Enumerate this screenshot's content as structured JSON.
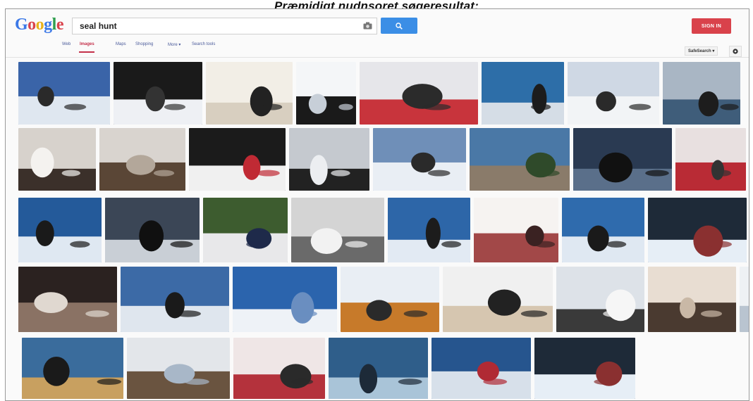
{
  "caption": "Præmidigt nudnsoret søgeresultat:",
  "header": {
    "logo_letters": [
      {
        "char": "G",
        "color": "#3b78e7"
      },
      {
        "char": "o",
        "color": "#d9424b"
      },
      {
        "char": "o",
        "color": "#e8b21c"
      },
      {
        "char": "g",
        "color": "#3b78e7"
      },
      {
        "char": "l",
        "color": "#2f9e4e"
      },
      {
        "char": "e",
        "color": "#d9424b"
      }
    ],
    "search": {
      "value": "seal hunt",
      "camera_icon": "camera-icon",
      "button_icon": "search-icon"
    },
    "signin_label": "SIGN IN"
  },
  "tabs": [
    {
      "label": "Web",
      "active": false
    },
    {
      "label": "Images",
      "active": true
    },
    {
      "label": "Maps",
      "active": false
    },
    {
      "label": "Shopping",
      "active": false
    },
    {
      "label": "More ▾",
      "active": false
    },
    {
      "label": "Search tools",
      "active": false
    }
  ],
  "toolbar": {
    "safesearch_label": "SafeSearch ▾",
    "settings_icon": "gear-icon"
  },
  "results": [
    {
      "scene": "ice-sled",
      "colors": [
        "#3a64a8",
        "#dfe7f0",
        "#2a2a2a"
      ]
    },
    {
      "scene": "dark-frame",
      "colors": [
        "#1a1a1a",
        "#eef0f4",
        "#333333"
      ]
    },
    {
      "scene": "white-pup",
      "colors": [
        "#f2eee6",
        "#d8cfc0",
        "#222222"
      ]
    },
    {
      "scene": "club-silhouette",
      "colors": [
        "#f4f6f8",
        "#1a1a1a",
        "#c7cfd8"
      ]
    },
    {
      "scene": "blood-ice-woman",
      "colors": [
        "#e6e6ea",
        "#c8343c",
        "#2b2b2b"
      ]
    },
    {
      "scene": "blue-sea-hunter",
      "colors": [
        "#2d6ea8",
        "#d5dde6",
        "#1c1c1c"
      ]
    },
    {
      "scene": "ice-hunters",
      "colors": [
        "#cfd8e4",
        "#f2f4f6",
        "#2a2a2a"
      ]
    },
    {
      "scene": "boat-ice",
      "colors": [
        "#a9b6c4",
        "#3f5d7a",
        "#1d1d1d"
      ]
    },
    {
      "scene": "seal-closeup",
      "colors": [
        "#d7d2cc",
        "#3b302a",
        "#f4f2ef"
      ]
    },
    {
      "scene": "hands-knife",
      "colors": [
        "#d9d4cf",
        "#5a4636",
        "#b3a79a"
      ]
    },
    {
      "scene": "blood-ice-dark",
      "colors": [
        "#1b1b1b",
        "#f0f0f0",
        "#c02a34"
      ]
    },
    {
      "scene": "gray-silhouette",
      "colors": [
        "#c5c9cf",
        "#222222",
        "#eceef1"
      ]
    },
    {
      "scene": "iceberg-person",
      "colors": [
        "#6f8fb8",
        "#e9eef4",
        "#2a2a2a"
      ]
    },
    {
      "scene": "blue-house",
      "colors": [
        "#4a78a6",
        "#8a7b6a",
        "#2f4a2a"
      ]
    },
    {
      "scene": "dark-water-hunter",
      "colors": [
        "#2a3a52",
        "#5a6f8a",
        "#111111"
      ]
    },
    {
      "scene": "red-ice",
      "colors": [
        "#e8e0e0",
        "#b92b35",
        "#333333"
      ]
    },
    {
      "scene": "iceberg-blue",
      "colors": [
        "#245a9a",
        "#dfe8f2",
        "#1a1a1a"
      ]
    },
    {
      "scene": "rifle-sunset",
      "colors": [
        "#3b4656",
        "#c9cfd6",
        "#101010"
      ]
    },
    {
      "scene": "group-people",
      "colors": [
        "#3d5c2f",
        "#e8e8ea",
        "#1e2a4a"
      ]
    },
    {
      "scene": "sketch-hunt",
      "colors": [
        "#d4d4d4",
        "#6a6a6a",
        "#f2f2f2"
      ]
    },
    {
      "scene": "iceberg-blue-2",
      "colors": [
        "#2d66a8",
        "#e2eaf3",
        "#1c1c1c"
      ]
    },
    {
      "scene": "red-boat",
      "colors": [
        "#f6f3f1",
        "#a24848",
        "#3a2222"
      ]
    },
    {
      "scene": "iceberg-blue-3",
      "colors": [
        "#2f6bad",
        "#dfe8f2",
        "#1a1a1a"
      ]
    },
    {
      "scene": "boat-blue-ice",
      "colors": [
        "#1e2a38",
        "#e6eef6",
        "#8a3030"
      ]
    },
    {
      "scene": "seal-pile",
      "colors": [
        "#2b2220",
        "#8a7264",
        "#e0d8d0"
      ]
    },
    {
      "scene": "sky-hunter",
      "colors": [
        "#3c6aa6",
        "#dfe6ee",
        "#1a1a1a"
      ]
    },
    {
      "scene": "sea-horizon",
      "colors": [
        "#2b64ad",
        "#eef2f7",
        "#6a8ec0"
      ]
    },
    {
      "scene": "lying-hunter",
      "colors": [
        "#e9eef4",
        "#c77a2a",
        "#2a2a2a"
      ]
    },
    {
      "scene": "sitting-woman",
      "colors": [
        "#f0f0f0",
        "#d6c6b0",
        "#222222"
      ]
    },
    {
      "scene": "kneeling-hunter",
      "colors": [
        "#dde2e8",
        "#3a3a3a",
        "#f6f6f6"
      ]
    },
    {
      "scene": "old-sketch",
      "colors": [
        "#e8ddd2",
        "#4a3a30",
        "#c9b8a6"
      ]
    },
    {
      "scene": "flat-ice-seal",
      "colors": [
        "#eef1f4",
        "#b9c4d0",
        "#1f1f1f"
      ]
    },
    {
      "scene": "boat-rifle",
      "colors": [
        "#3a6c9c",
        "#c8a060",
        "#1a1a1a"
      ]
    },
    {
      "scene": "dog-sled",
      "colors": [
        "#e3e6ea",
        "#6a5440",
        "#a8b7c8"
      ]
    },
    {
      "scene": "red-seals",
      "colors": [
        "#efe6e6",
        "#b4323c",
        "#2a2a2a"
      ]
    },
    {
      "scene": "wave-seal",
      "colors": [
        "#2f5e8a",
        "#a9c4d8",
        "#1d2a38"
      ]
    },
    {
      "scene": "iceberg-hunter",
      "colors": [
        "#26558e",
        "#d7e0ea",
        "#b02a34"
      ]
    },
    {
      "scene": "boat-blue-ice-2",
      "colors": [
        "#1e2a38",
        "#e6eef6",
        "#8a3030"
      ]
    }
  ]
}
